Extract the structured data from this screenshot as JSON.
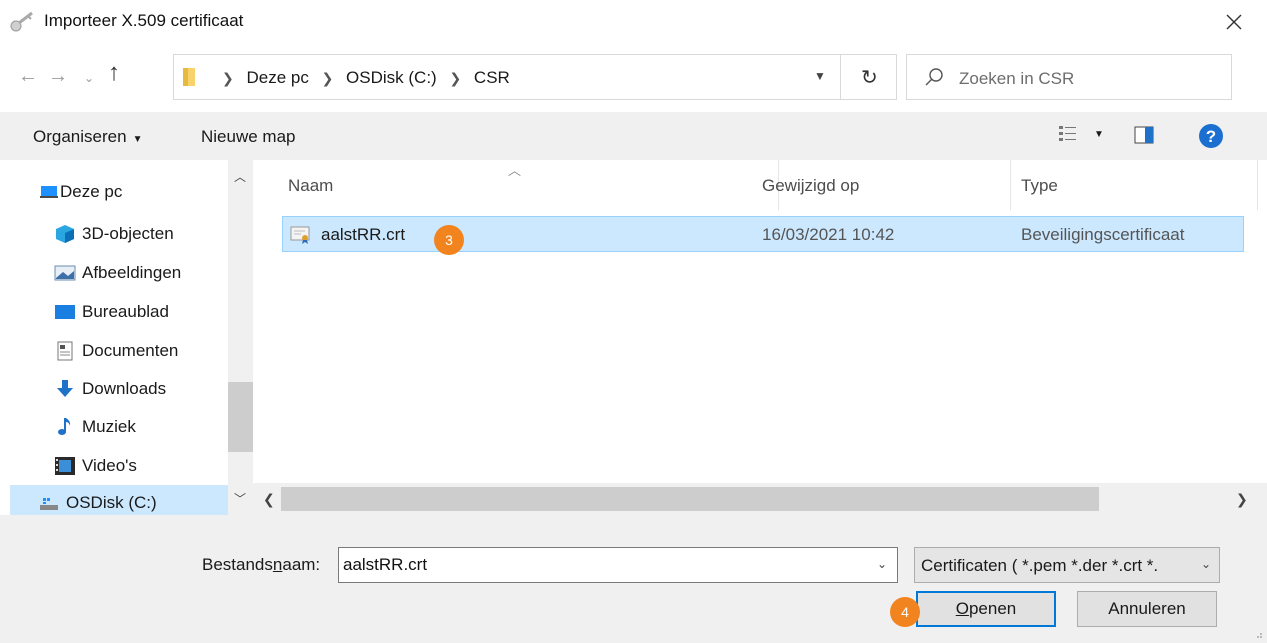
{
  "window": {
    "title": "Importeer X.509 certificaat",
    "close_label": "×"
  },
  "navigation": {
    "breadcrumbs": [
      "Deze pc",
      "OSDisk (C:)",
      "CSR"
    ],
    "search_placeholder": "Zoeken in CSR"
  },
  "toolbar": {
    "organize_label": "Organiseren",
    "new_folder_label": "Nieuwe map"
  },
  "sidebar": {
    "items": [
      {
        "label": "Deze pc",
        "icon": "computer-icon"
      },
      {
        "label": "3D-objecten",
        "icon": "cube-icon"
      },
      {
        "label": "Afbeeldingen",
        "icon": "pictures-icon"
      },
      {
        "label": "Bureaublad",
        "icon": "desktop-icon"
      },
      {
        "label": "Documenten",
        "icon": "documents-icon"
      },
      {
        "label": "Downloads",
        "icon": "download-icon"
      },
      {
        "label": "Muziek",
        "icon": "music-icon"
      },
      {
        "label": "Video's",
        "icon": "video-icon"
      },
      {
        "label": "OSDisk (C:)",
        "icon": "drive-icon",
        "selected": true
      }
    ]
  },
  "filelist": {
    "columns": [
      "Naam",
      "Gewijzigd op",
      "Type"
    ],
    "rows": [
      {
        "name": "aalstRR.crt",
        "modified": "16/03/2021 10:42",
        "type": "Beveiligingscertificaat",
        "selected": true
      }
    ]
  },
  "annotations": {
    "step3": "3",
    "step4": "4",
    "badge_color": "#f2841f"
  },
  "footer": {
    "filename_label_pre": "Bestands",
    "filename_label_u": "n",
    "filename_label_post": "aam:",
    "filename_value": "aalstRR.crt",
    "filter_text": "Certificaten ( *.pem *.der *.crt *.",
    "open_u": "O",
    "open_rest": "penen",
    "cancel_label": "Annuleren"
  },
  "colors": {
    "selection": "#cce8ff",
    "accent": "#0078d7"
  }
}
